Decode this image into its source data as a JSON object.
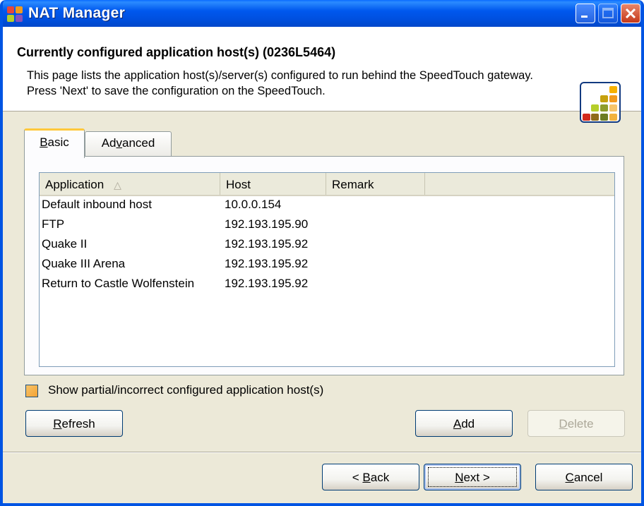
{
  "window": {
    "title": "NAT Manager"
  },
  "header": {
    "title": "Currently configured application host(s) (0236L5464)",
    "description": "This page lists the application host(s)/server(s) configured to run behind the SpeedTouch gateway. Press 'Next' to save the configuration on the SpeedTouch."
  },
  "tabs": [
    {
      "label_pre": "",
      "label_key": "B",
      "label_post": "asic",
      "active": true
    },
    {
      "label_pre": "Ad",
      "label_key": "v",
      "label_post": "anced",
      "active": false
    }
  ],
  "list": {
    "columns": [
      "Application",
      "Host",
      "Remark"
    ],
    "sort_indicator": "△",
    "rows": [
      {
        "application": "Default inbound host",
        "host": "10.0.0.154",
        "remark": ""
      },
      {
        "application": "FTP",
        "host": "192.193.195.90",
        "remark": ""
      },
      {
        "application": "Quake II",
        "host": "192.193.195.92",
        "remark": ""
      },
      {
        "application": "Quake III Arena",
        "host": "192.193.195.92",
        "remark": ""
      },
      {
        "application": "Return to Castle Wolfenstein",
        "host": "192.193.195.92",
        "remark": ""
      }
    ]
  },
  "options": {
    "show_partial_label": "Show partial/incorrect configured application host(s)",
    "show_partial_checked": false
  },
  "buttons": {
    "refresh": {
      "key": "R",
      "rest": "efresh"
    },
    "add": {
      "key": "A",
      "rest": "dd"
    },
    "delete": {
      "key": "D",
      "rest": "elete",
      "enabled": false
    },
    "back": {
      "pre": "< ",
      "key": "B",
      "rest": "ack"
    },
    "next": {
      "key": "N",
      "rest": "ext >"
    },
    "cancel": {
      "key": "C",
      "rest": "ancel"
    }
  },
  "colors": {
    "title_bar": "#0058ee",
    "accent": "#ffc83c",
    "window_bg": "#ece9d8"
  },
  "icons": [
    "app-grid-icon",
    "minimize-icon",
    "maximize-icon",
    "close-icon",
    "speedtouch-logo-icon"
  ]
}
